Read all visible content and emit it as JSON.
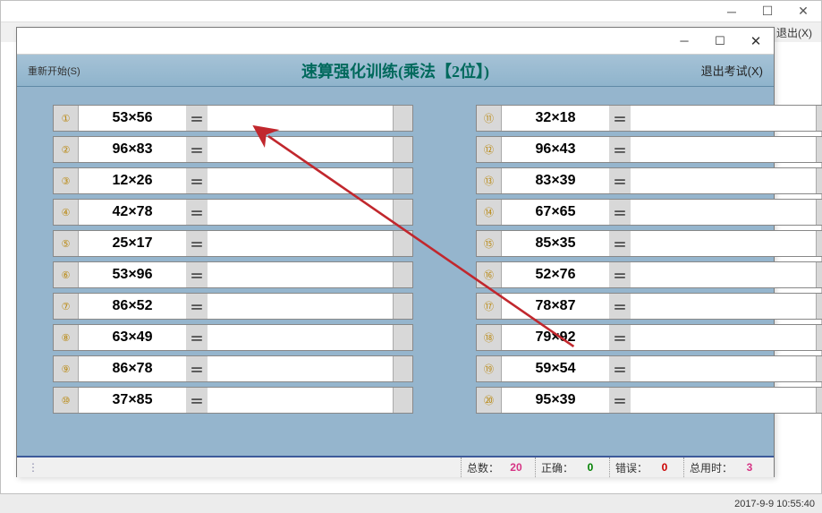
{
  "outer": {
    "exit_label": "退出(X)",
    "timestamp": "2017-9-9 10:55:40"
  },
  "header": {
    "restart_label": "重新开始(S)",
    "title": "速算强化训练(乘法【2位】)",
    "exit_exam_label": "退出考试(X)"
  },
  "problems_left": [
    {
      "idx": "①",
      "expr": "53×56"
    },
    {
      "idx": "②",
      "expr": "96×83"
    },
    {
      "idx": "③",
      "expr": "12×26"
    },
    {
      "idx": "④",
      "expr": "42×78"
    },
    {
      "idx": "⑤",
      "expr": "25×17"
    },
    {
      "idx": "⑥",
      "expr": "53×96"
    },
    {
      "idx": "⑦",
      "expr": "86×52"
    },
    {
      "idx": "⑧",
      "expr": "63×49"
    },
    {
      "idx": "⑨",
      "expr": "86×78"
    },
    {
      "idx": "⑩",
      "expr": "37×85"
    }
  ],
  "problems_right": [
    {
      "idx": "⑪",
      "expr": "32×18"
    },
    {
      "idx": "⑫",
      "expr": "96×43"
    },
    {
      "idx": "⑬",
      "expr": "83×39"
    },
    {
      "idx": "⑭",
      "expr": "67×65"
    },
    {
      "idx": "⑮",
      "expr": "85×35"
    },
    {
      "idx": "⑯",
      "expr": "52×76"
    },
    {
      "idx": "⑰",
      "expr": "78×87"
    },
    {
      "idx": "⑱",
      "expr": "79×92"
    },
    {
      "idx": "⑲",
      "expr": "59×54"
    },
    {
      "idx": "⑳",
      "expr": "95×39"
    }
  ],
  "equals": "＝",
  "status": {
    "total_label": "总数：",
    "total_val": "20",
    "correct_label": "正确：",
    "correct_val": "0",
    "wrong_label": "错误：",
    "wrong_val": "0",
    "time_label": "总用时：",
    "time_val": "3"
  }
}
